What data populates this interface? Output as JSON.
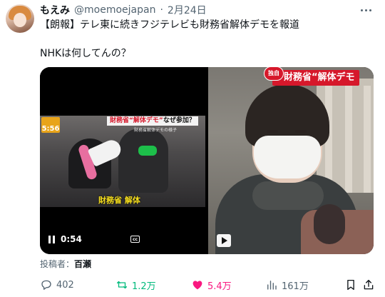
{
  "author": {
    "name": "もえみ",
    "handle": "@moemoejapan",
    "separator": "·",
    "date": "2月24日"
  },
  "tweet": {
    "line1": "【朗報】テレ東に続きフジテレビも財務省解体デモを報道",
    "line2": "NHKは何してんの？"
  },
  "media": {
    "video1": {
      "corner_badge": "5:56",
      "headline_red": "財務省“解体デモ”",
      "headline_black": "なぜ参加？",
      "subheadline": "財務省解体デモの様子",
      "caption": "財務省 解体",
      "duration": "0:54",
      "cc_label": "cc"
    },
    "video2": {
      "badge": "独自",
      "banner": "財務省“解体デモ"
    }
  },
  "credit": {
    "prefix": "投稿者：",
    "name": "百瀬"
  },
  "actions": {
    "replies": "402",
    "retweets": "1.2万",
    "likes": "5.4万",
    "views": "161万"
  },
  "colors": {
    "text": "#0f1419",
    "secondary": "#536471",
    "retweet": "#00ba7c",
    "like": "#f91880",
    "news_red": "#d6182b"
  },
  "icons": [
    "more-icon",
    "reply-icon",
    "retweet-icon",
    "like-icon",
    "views-icon",
    "bookmark-icon",
    "share-icon",
    "pause-icon",
    "play-icon",
    "cc-icon"
  ]
}
